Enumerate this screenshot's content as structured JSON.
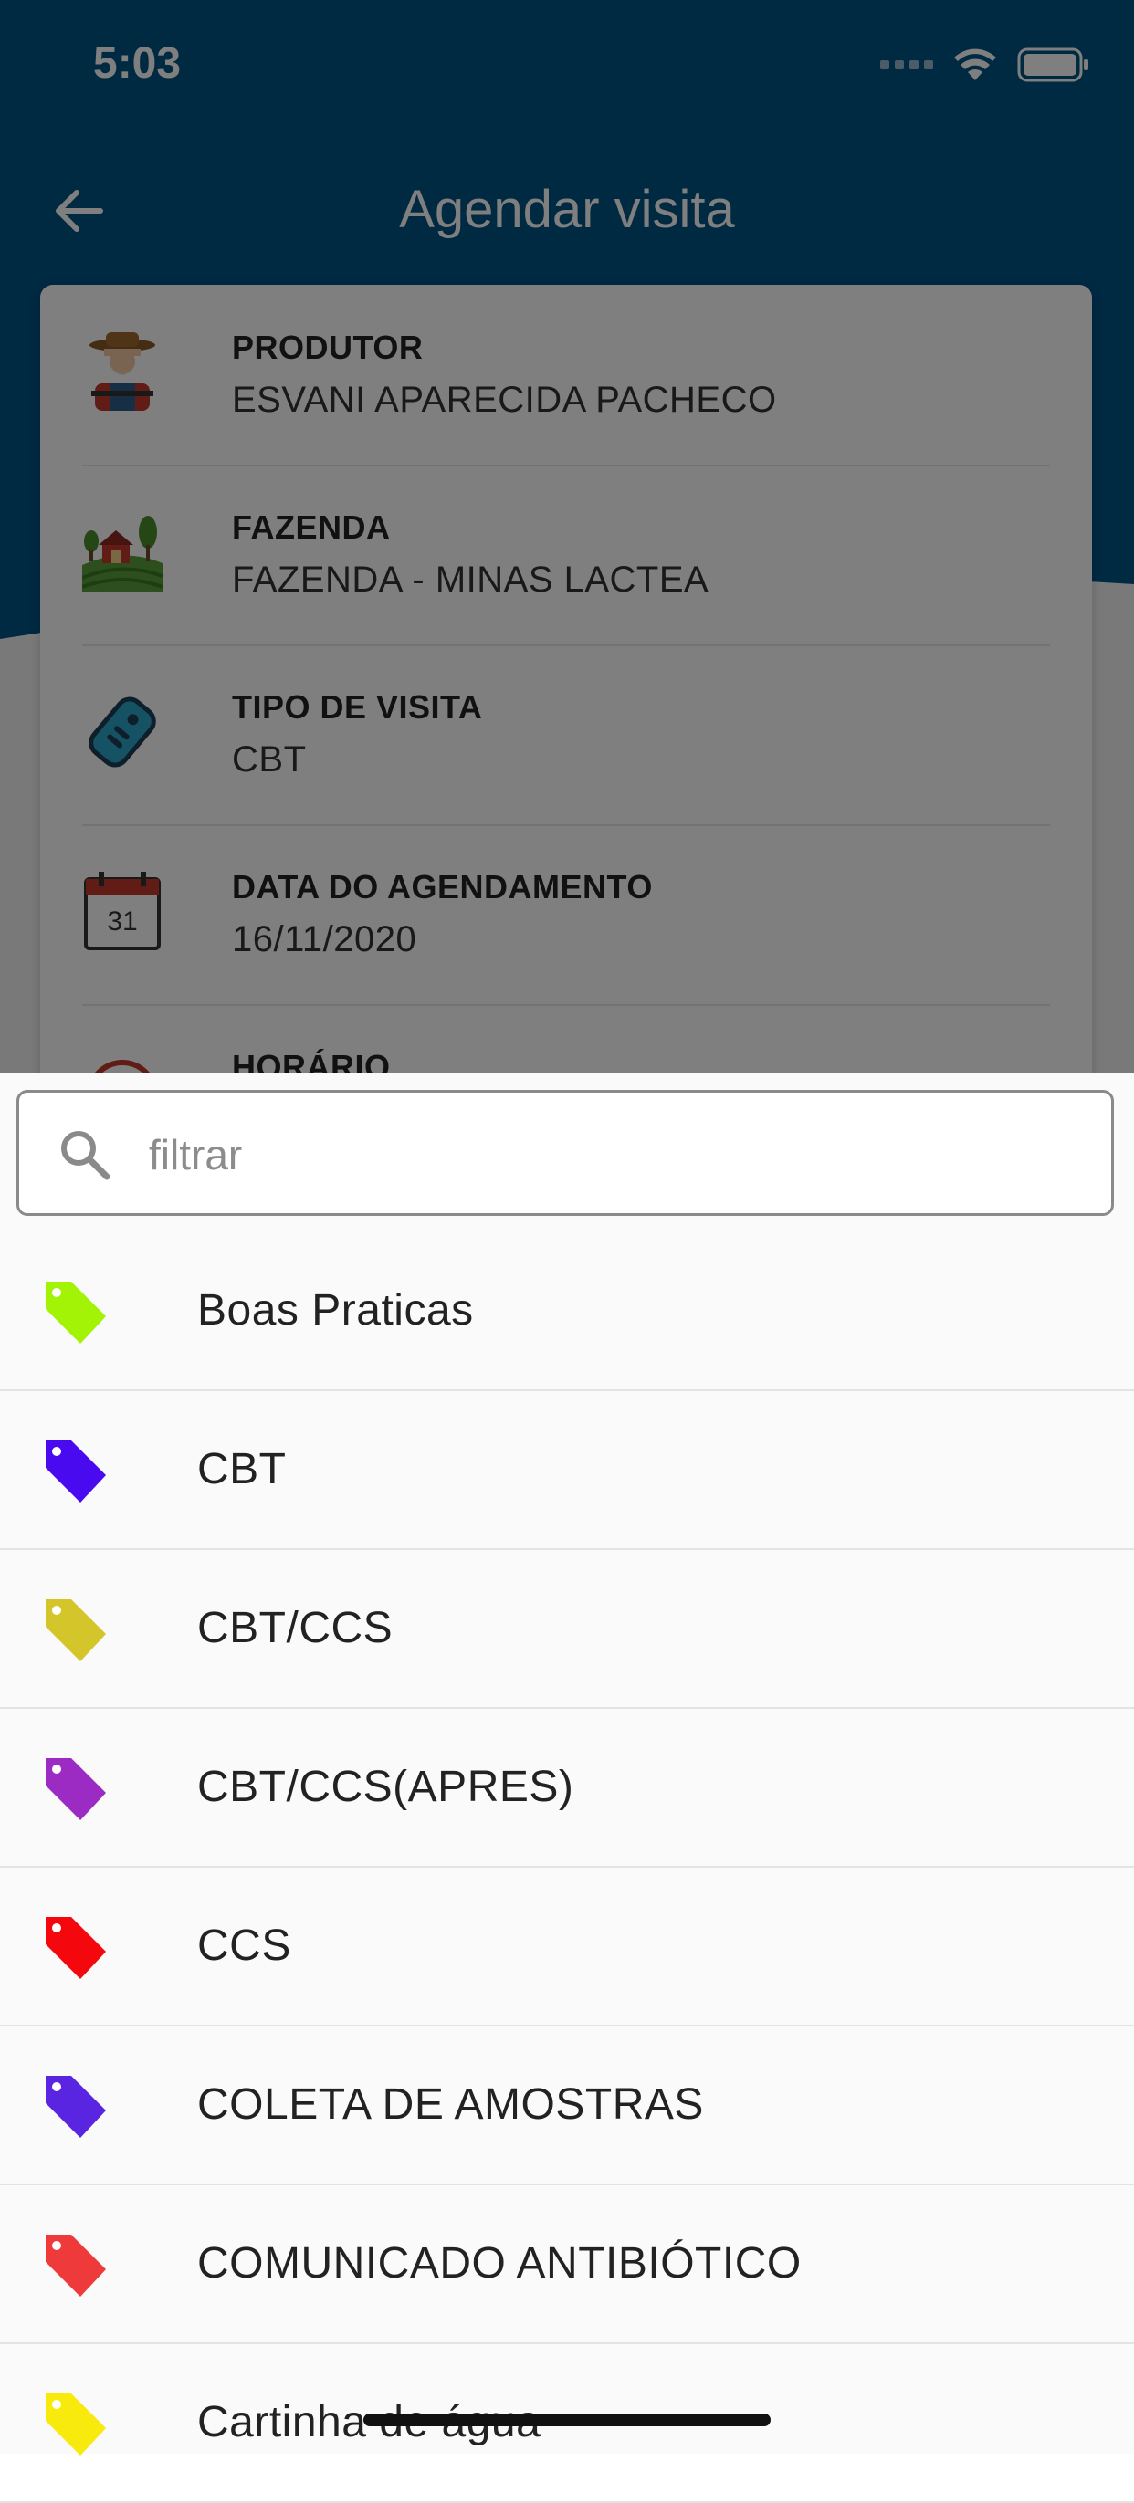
{
  "status_bar": {
    "time": "5:03"
  },
  "header": {
    "title": "Agendar visita"
  },
  "card": {
    "rows": [
      {
        "label": "PRODUTOR",
        "value": "ESVANI APARECIDA PACHECO",
        "icon": "farmer-icon"
      },
      {
        "label": "FAZENDA",
        "value": "FAZENDA - MINAS LACTEA",
        "icon": "farm-icon"
      },
      {
        "label": "TIPO DE VISITA",
        "value": "CBT",
        "icon": "tag-icon"
      },
      {
        "label": "DATA DO AGENDAMENTO",
        "value": "16/11/2020",
        "icon": "calendar-icon",
        "calendar_day": "31"
      },
      {
        "label": "HORÁRIO",
        "value": "",
        "icon": "clock-icon"
      }
    ]
  },
  "search": {
    "placeholder": "filtrar",
    "value": ""
  },
  "options": [
    {
      "label": "Boas Praticas",
      "color": "#a3f306"
    },
    {
      "label": "CBT",
      "color": "#4a0af0"
    },
    {
      "label": "CBT/CCS",
      "color": "#d4c52a"
    },
    {
      "label": "CBT/CCS(APRES)",
      "color": "#9c2bc4"
    },
    {
      "label": "CCS",
      "color": "#f5070e"
    },
    {
      "label": "COLETA DE AMOSTRAS",
      "color": "#5a25e0"
    },
    {
      "label": "COMUNICADO ANTIBIÓTICO",
      "color": "#ee3a3a"
    },
    {
      "label": "Cartinha de água",
      "color": "#f7ea0c"
    }
  ]
}
